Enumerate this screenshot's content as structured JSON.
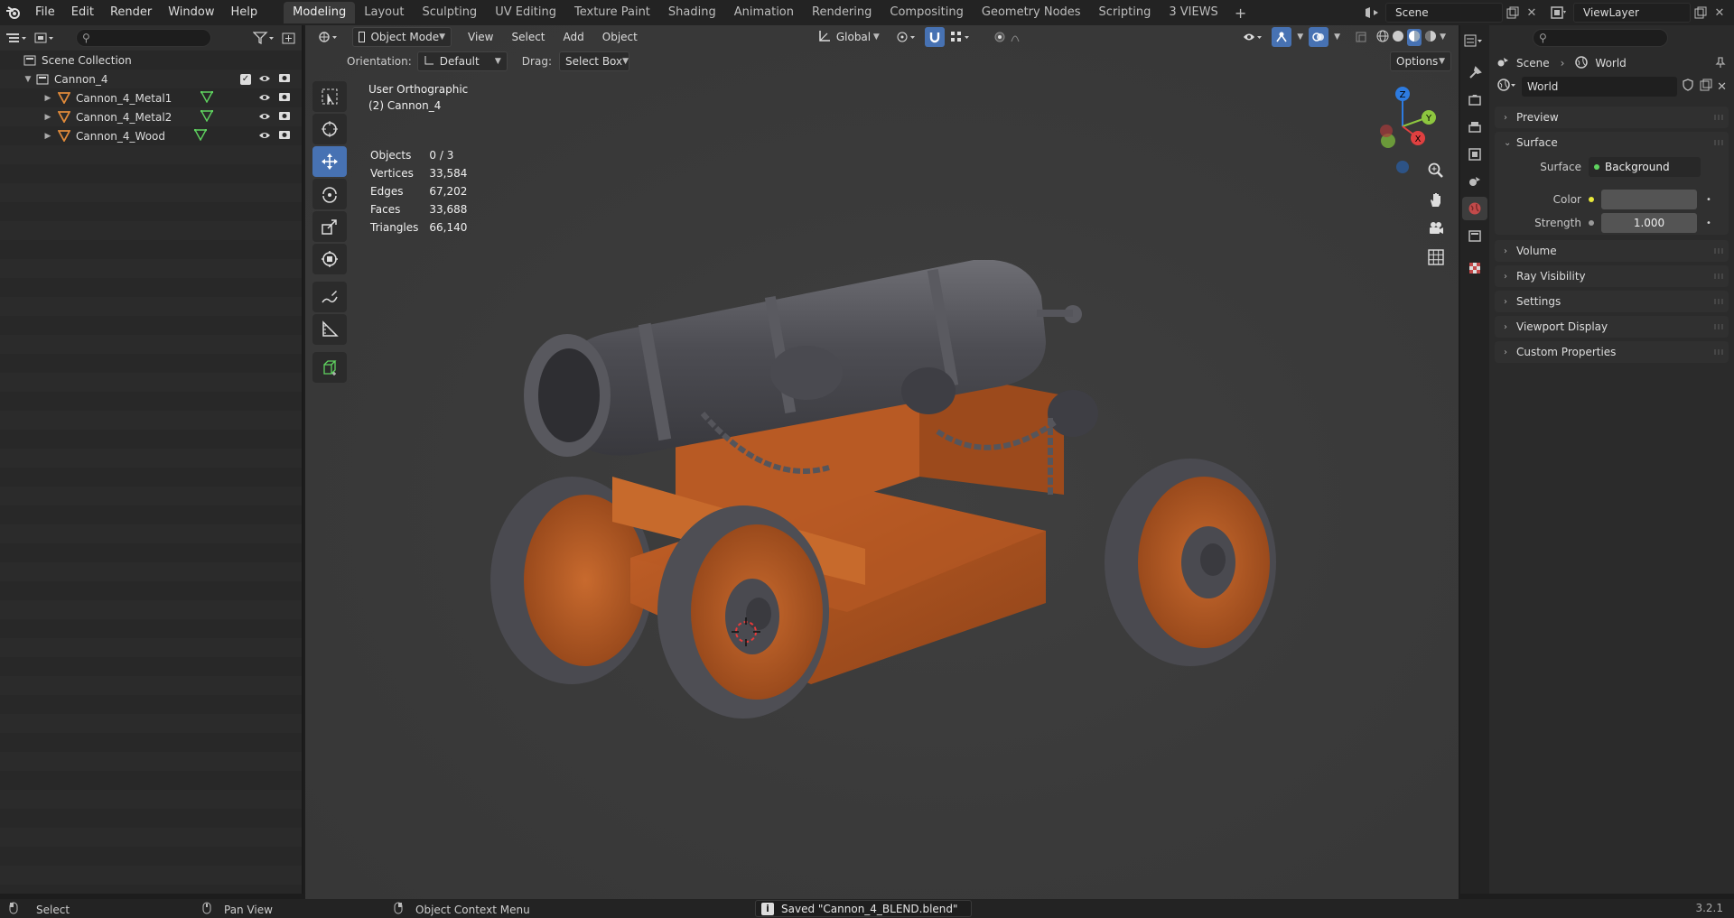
{
  "topbar": {
    "menus": [
      "File",
      "Edit",
      "Render",
      "Window",
      "Help"
    ],
    "workspaces": [
      "Modeling",
      "Layout",
      "Sculpting",
      "UV Editing",
      "Texture Paint",
      "Shading",
      "Animation",
      "Rendering",
      "Compositing",
      "Geometry Nodes",
      "Scripting",
      "3 VIEWS"
    ],
    "active_workspace": "Modeling",
    "add_label": "+",
    "scene": "Scene",
    "view_layer": "ViewLayer"
  },
  "outliner": {
    "root": "Scene Collection",
    "collection": "Cannon_4",
    "objects": [
      "Cannon_4_Metal1",
      "Cannon_4_Metal2",
      "Cannon_4_Wood"
    ]
  },
  "viewport": {
    "mode": "Object Mode",
    "menus": [
      "View",
      "Select",
      "Add",
      "Object"
    ],
    "transform_orientation": "Global",
    "orientation_label": "Orientation:",
    "orientation_value": "Default",
    "drag_label": "Drag:",
    "drag_value": "Select Box",
    "options_label": "Options",
    "view_name": "User Orthographic",
    "active_object": "(2) Cannon_4",
    "stats": [
      {
        "label": "Objects",
        "value": "0 / 3"
      },
      {
        "label": "Vertices",
        "value": "33,584"
      },
      {
        "label": "Edges",
        "value": "67,202"
      },
      {
        "label": "Faces",
        "value": "33,688"
      },
      {
        "label": "Triangles",
        "value": "66,140"
      }
    ],
    "gizmo": {
      "x": "X",
      "y": "Y",
      "z": "Z"
    }
  },
  "properties": {
    "breadcrumb_scene": "Scene",
    "breadcrumb_world": "World",
    "world_name": "World",
    "panels": {
      "preview": "Preview",
      "surface": "Surface",
      "volume": "Volume",
      "ray_visibility": "Ray Visibility",
      "settings": "Settings",
      "viewport_display": "Viewport Display",
      "custom_properties": "Custom Properties"
    },
    "surface_label": "Surface",
    "surface_value": "Background",
    "color_label": "Color",
    "color_value": "#545454",
    "strength_label": "Strength",
    "strength_value": "1.000"
  },
  "statusbar": {
    "select": "Select",
    "pan_view": "Pan View",
    "context_menu": "Object Context Menu",
    "message": "Saved \"Cannon_4_BLEND.blend\"",
    "version": "3.2.1"
  },
  "colors": {
    "accent": "#4772b3",
    "mesh_icon": "#e08a3a",
    "vertex_icon": "#5fd35f"
  }
}
